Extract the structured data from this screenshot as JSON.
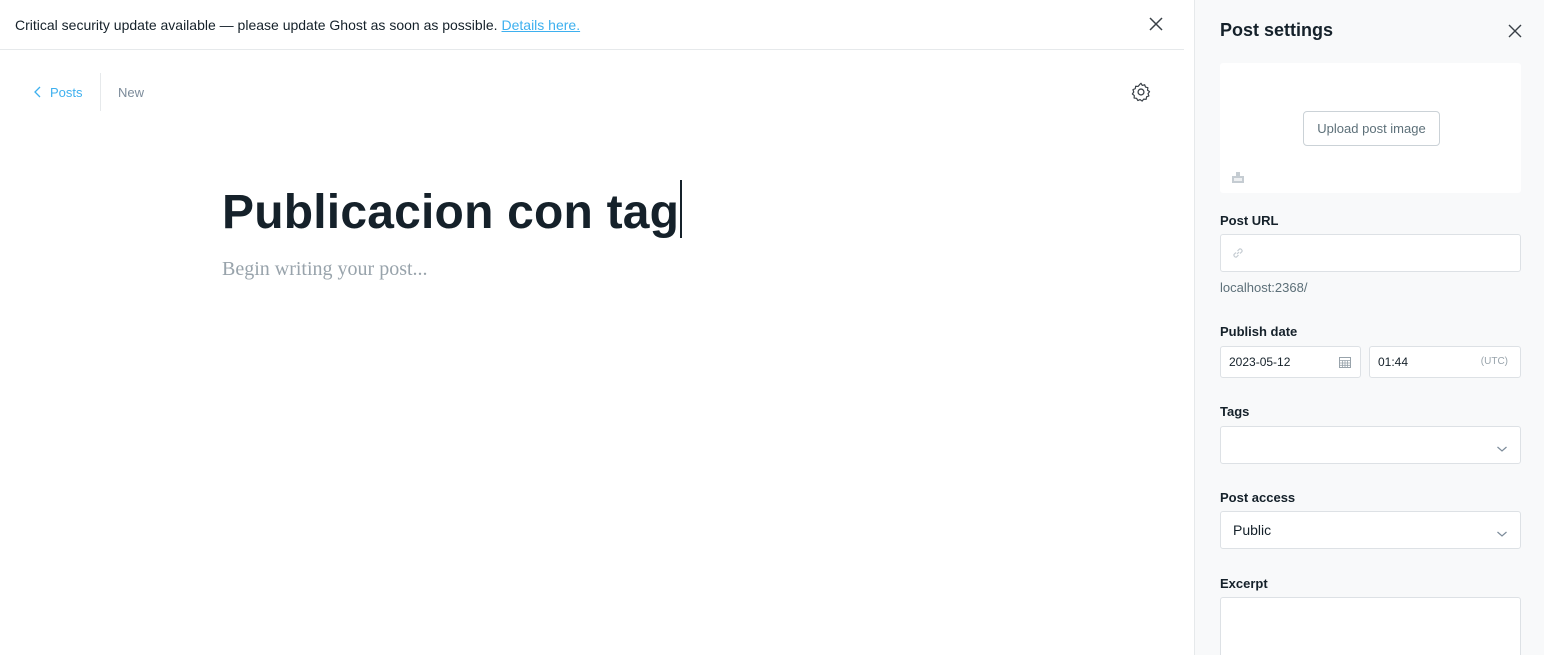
{
  "alert": {
    "message": "Critical security update available — please update Ghost as soon as possible.",
    "link_text": "Details here."
  },
  "topbar": {
    "back_label": "Posts",
    "status": "New"
  },
  "post": {
    "title": "Publicacion con tag",
    "body_placeholder": "Begin writing your post..."
  },
  "sidebar": {
    "title": "Post settings",
    "upload_label": "Upload post image",
    "post_url_label": "Post URL",
    "post_url_value": "",
    "post_url_hint": "localhost:2368/",
    "publish_date_label": "Publish date",
    "publish_date": "2023-05-12",
    "publish_time": "01:44",
    "timezone": "(UTC)",
    "tags_label": "Tags",
    "tags_value": "",
    "access_label": "Post access",
    "access_value": "Public",
    "excerpt_label": "Excerpt",
    "excerpt_value": ""
  },
  "colors": {
    "accent": "#3eb0ef",
    "text": "#15212a",
    "muted": "#7c8b9a",
    "sidebar_bg": "#f8f9fa",
    "border": "#dde1e5"
  }
}
